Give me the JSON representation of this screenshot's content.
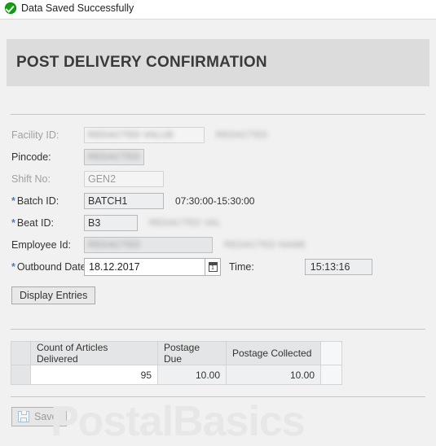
{
  "message": {
    "icon": "success-check-icon",
    "text": "Data Saved Successfully"
  },
  "header": {
    "title": "POST DELIVERY CONFIRMATION"
  },
  "watermark": "PostalBasics",
  "form": {
    "fields": [
      {
        "label": "Facility ID:",
        "required": false,
        "dim": true,
        "value": "REDACTED VALUE",
        "redacted": true,
        "state": "readonly",
        "side": "REDACTED",
        "side_redacted": true
      },
      {
        "label": "Pincode:",
        "required": false,
        "dim": false,
        "value": "REDACTED",
        "redacted": true,
        "state": "disabled",
        "side": "",
        "side_redacted": false
      },
      {
        "label": "Shift No:",
        "required": false,
        "dim": true,
        "value": "GEN2",
        "redacted": false,
        "state": "readonly",
        "side": "",
        "side_redacted": false
      },
      {
        "label": "Batch ID:",
        "required": true,
        "dim": false,
        "value": "BATCH1",
        "redacted": false,
        "state": "editable",
        "side": "07:30:00-15:30:00",
        "side_redacted": false
      },
      {
        "label": "Beat ID:",
        "required": true,
        "dim": false,
        "value": "B3",
        "redacted": false,
        "state": "editable",
        "side": "REDACTED VAL",
        "side_redacted": true
      },
      {
        "label": "Employee Id:",
        "required": false,
        "dim": false,
        "value": "REDACTED",
        "redacted": true,
        "state": "disabled",
        "side": "REDACTED NAME",
        "side_redacted": true
      }
    ],
    "outbound": {
      "label": "Outbound Date:",
      "required": true,
      "date_value": "18.12.2017",
      "calendar_icon": "calendar-icon",
      "time_label": "Time:",
      "time_value": "15:13:16"
    },
    "display_entries_label": "Display Entries"
  },
  "table": {
    "columns": [
      "",
      "Count of Articles Delivered",
      "Postage Due",
      "Postage Collected",
      ""
    ],
    "rows": [
      {
        "select": "",
        "count": "95",
        "due": "10.00",
        "collected": "10.00",
        "filler": ""
      }
    ]
  },
  "footer": {
    "save_label": "Save",
    "save_icon": "floppy-disk-icon"
  },
  "colors": {
    "success_green": "#12a012",
    "required_blue": "#4a7ebb",
    "header_gray": "#dcdcdc",
    "page_bg": "#f1f1f1"
  }
}
